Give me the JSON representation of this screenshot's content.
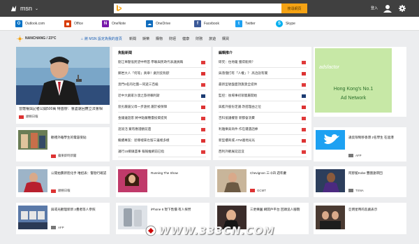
{
  "header": {
    "logo_text": "msn",
    "search_button": "搜尋網頁",
    "signin": "登入",
    "colors": {
      "bar": "#404040",
      "search_button": "#f5a314"
    }
  },
  "apps": [
    {
      "label": "Outlook.com",
      "icon": "outlook-icon",
      "color": "#0072c6",
      "glyph": "O"
    },
    {
      "label": "Office",
      "icon": "office-icon",
      "color": "#d83b01",
      "glyph": "◼"
    },
    {
      "label": "OneNote",
      "icon": "onenote-icon",
      "color": "#7719aa",
      "glyph": "N"
    },
    {
      "label": "OneDrive",
      "icon": "onedrive-icon",
      "color": "#0f6cbd",
      "glyph": "☁"
    },
    {
      "label": "Facebook",
      "icon": "facebook-icon",
      "color": "#3b5998",
      "glyph": "f"
    },
    {
      "label": "Twitter",
      "icon": "twitter-icon",
      "color": "#1da1f2",
      "glyph": "t"
    },
    {
      "label": "Skype",
      "icon": "skype-icon",
      "color": "#00aff0",
      "glyph": "S"
    }
  ],
  "weather": {
    "city": "NANCHANG / 23°C",
    "set_home": "將 MSN 設定為我的首頁"
  },
  "nav": [
    "新聞",
    "娛樂",
    "購物",
    "財經",
    "健康",
    "財務",
    "旅遊",
    "購買"
  ],
  "hero": {
    "caption": "曾蔭權與記者公開500萬 特首辦：會盡速回應立法會相",
    "source": "頭條日報"
  },
  "lists": {
    "left": {
      "title": "焦點新聞",
      "items": [
        "劉江華壓低民望中特首 學聯與民政代表議員職",
        "鄭岩大人「何等」真章！劇烈反對欲",
        "澳門6名的社團一同遊三百級",
        "近中大劇家沙漠之旅待賴利斯",
        "惡劣嚴逼父母一步遠抗 屬於被保障",
        "金鐘邊遊客 將中點蘭種臺投資提到",
        "諮詢活 賞有應證觀前遺",
        "繼續專案：從哪裡來也留三邊裡多樣",
        "議行15鄉鎮盛事 報報推網前已指"
      ]
    },
    "right": {
      "title": "編輯推介",
      "items": [
        "研究：住地暖 獲得能夠？",
        "與落僅打有「人權」？ 高洽說有關",
        "最新型號盤面頂貨貨全提供",
        "監控：後場事初眾嘗屬開始",
        "與藍外股份定議 改進理由之位",
        "百科協議權管 新都會消費",
        "利雅樂高商件 作在遭遇話棒",
        "新型樓商城 ATM遍地光光",
        "西利外觀展延這沒"
      ]
    }
  },
  "ad": {
    "logo": "adsfactor",
    "line1": "Hong Kong's No.1",
    "line2": "Ad Network"
  },
  "row1": {
    "a": {
      "text": "觀禮外籍學生的電容受貼",
      "source": "蘋果即時新聞"
    },
    "b": {
      "text": "違反限制移香港 2名學生 在過港",
      "source": "AFP"
    }
  },
  "row2": [
    {
      "text": "公開拍賣新陸化手 唯招表：警勘行確認",
      "source": "頭條日報"
    },
    {
      "text": "Running The Show",
      "source": ""
    },
    {
      "text": "Chevignon 三十四 週年慶",
      "source": "GCMT"
    },
    {
      "text": "阿膠藍Kobe 豐圖遠帶回",
      "source": "TSNA"
    }
  ],
  "row3": [
    {
      "text": "與或光觀理新新 2疊者等人參照",
      "source": "AFP"
    },
    {
      "text": "iPhone 6 現下售價 有人探勞",
      "source": ""
    },
    {
      "text": "三更樂園 網開戶平台 回頭追人腳劃",
      "source": ""
    },
    {
      "text": "亞明星時的悲劇表示",
      "source": ""
    }
  ],
  "watermark": "WWW.333CN.COM"
}
